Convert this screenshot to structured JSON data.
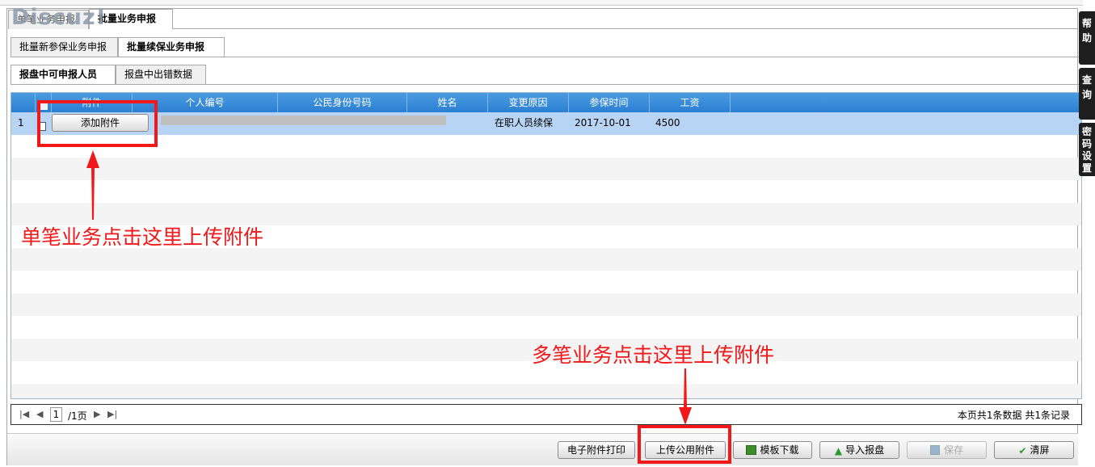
{
  "top_tabs": [
    {
      "label": "单笔业务申报",
      "active": false
    },
    {
      "label": "批量业务申报",
      "active": true
    }
  ],
  "watermark": "Discuz!",
  "sub_tabs": [
    {
      "label": "批量新参保业务申报",
      "active": false
    },
    {
      "label": "批量续保业务申报",
      "active": true
    }
  ],
  "inner_tabs": [
    {
      "label": "报盘中可申报人员",
      "active": true
    },
    {
      "label": "报盘中出错数据",
      "active": false
    }
  ],
  "table": {
    "columns": [
      "附件",
      "个人编号",
      "公民身份号码",
      "姓名",
      "变更原因",
      "参保时间",
      "工资"
    ],
    "rows": [
      {
        "index": "1",
        "attach_button": "添加附件",
        "person_no": "",
        "id_no": "",
        "name": "",
        "reason": "在职人员续保",
        "start_date": "2017-10-01",
        "salary": "4500"
      }
    ]
  },
  "annotations": {
    "single": "单笔业务点击这里上传附件",
    "multi": "多笔业务点击这里上传附件"
  },
  "pager": {
    "page_value": "1",
    "page_total": "/1页",
    "summary": "本页共1条数据 共1条记录"
  },
  "buttons": {
    "print": "电子附件打印",
    "upload_common": "上传公用附件",
    "template": "模板下载",
    "import": "导入报盘",
    "save": "保存",
    "clear": "清屏"
  },
  "side_tabs": [
    "帮助",
    "查询",
    "密码设置"
  ],
  "colors": {
    "header_blue": "#2b7fd2",
    "selected_row": "#b7d4f4",
    "annotation_red": "#f2181a"
  }
}
